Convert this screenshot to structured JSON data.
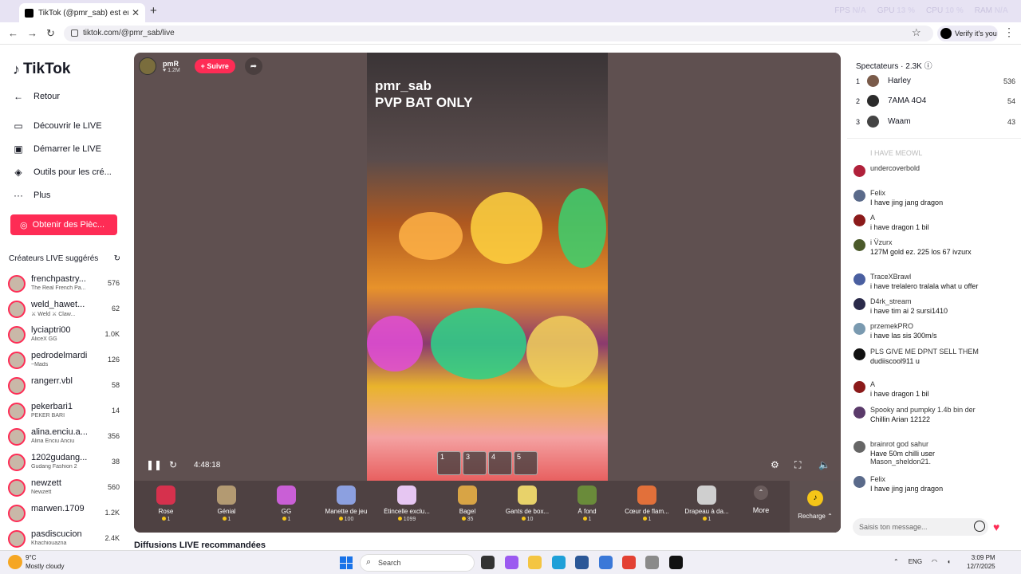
{
  "browser": {
    "tab_title": "TikTok (@pmr_sab) est en LIV",
    "url": "tiktok.com/@pmr_sab/live",
    "verify_label": "Verify it's you",
    "perf": [
      {
        "label": "FPS",
        "value": "N/A"
      },
      {
        "label": "GPU",
        "value": "13 %"
      },
      {
        "label": "CPU",
        "value": "10 %"
      },
      {
        "label": "RAM",
        "value": "N/A"
      }
    ]
  },
  "sidebar": {
    "logo": "TikTok",
    "nav": [
      "Retour",
      "Découvrir le LIVE",
      "Démarrer le LIVE",
      "Outils pour les cré...",
      "Plus"
    ],
    "coins_button": "Obtenir des Pièc...",
    "suggested_title": "Créateurs LIVE suggérés",
    "creators": [
      {
        "name": "frenchpastry...",
        "sub": "The Real French Pa...",
        "count": "576"
      },
      {
        "name": "weld_hawet...",
        "sub": "⚔ Weld ⚔ Claw...",
        "count": "62"
      },
      {
        "name": "lyciaptri00",
        "sub": "AliceX GG",
        "count": "1.0K"
      },
      {
        "name": "pedrodelmardi",
        "sub": "~Mads",
        "count": "126"
      },
      {
        "name": "rangerr.vbl",
        "sub": "",
        "count": "58"
      },
      {
        "name": "pekerbari1",
        "sub": "PEKER BARI",
        "count": "14"
      },
      {
        "name": "alina.enciu.a...",
        "sub": "Alina Enciu Anciu",
        "count": "356"
      },
      {
        "name": "1202gudang...",
        "sub": "Gudang Fashion 2",
        "count": "38"
      },
      {
        "name": "newzett",
        "sub": "Newzett",
        "count": "560"
      },
      {
        "name": "marwen.1709",
        "sub": "",
        "count": "1.2K"
      },
      {
        "name": "pasdiscucion",
        "sub": "Khachiouazna",
        "count": "2.4K"
      }
    ]
  },
  "live": {
    "host_name": "pmR",
    "host_likes": "1.2M",
    "follow_label": "+ Suivre",
    "streamer_overlay": "pmr_sab",
    "caption": "PVP BAT ONLY",
    "elapsed": "4:48:18",
    "hotbar": [
      "1",
      "3",
      "4",
      "5"
    ]
  },
  "gifts": [
    {
      "name": "Rose",
      "price": "1",
      "color": "#d6314d"
    },
    {
      "name": "Génial",
      "price": "1",
      "color": "#b39a72"
    },
    {
      "name": "GG",
      "price": "1",
      "color": "#c95fd6"
    },
    {
      "name": "Manette de jeu",
      "price": "100",
      "color": "#8ca0e0"
    },
    {
      "name": "Étincelle exclu...",
      "price": "1099",
      "color": "#e6c6f2"
    },
    {
      "name": "Bagel",
      "price": "35",
      "color": "#d8a445"
    },
    {
      "name": "Gants de box...",
      "price": "10",
      "color": "#e8d26a"
    },
    {
      "name": "À fond",
      "price": "1",
      "color": "#6a8b3a"
    },
    {
      "name": "Cœur de flam...",
      "price": "1",
      "color": "#e2703a"
    },
    {
      "name": "Drapeau à da...",
      "price": "1",
      "color": "#cfcfcf"
    }
  ],
  "more_label": "More",
  "recharge_label": "Recharge",
  "recommended_title": "Diffusions LIVE recommandées",
  "chat": {
    "spectators_label": "Spectateurs · 2.3K",
    "top": [
      {
        "rank": "1",
        "name": "Harley",
        "count": "536",
        "color": "#7a5b4a"
      },
      {
        "rank": "2",
        "name": "7AMA 4O4",
        "count": "54",
        "color": "#2b2b2b"
      },
      {
        "rank": "3",
        "name": "Waam",
        "count": "43",
        "color": "#444"
      }
    ],
    "faded": "I HAVE MEOWL",
    "messages": [
      {
        "name": "undercoverbold",
        "text": "",
        "color": "#b0203a"
      },
      {
        "name": "Felix",
        "text": "I have jing jang dragon",
        "color": "#5a6a8a"
      },
      {
        "name": "A",
        "text": "i have dragon 1 bil",
        "color": "#8b1a1a"
      },
      {
        "name": "i V̈zurx",
        "text": "127M gold ez. 225 los 67 ivzurx",
        "color": "#4b5a2a"
      },
      {
        "name": "TraceXBrawl",
        "text": "i have trelalero tralala what u offer",
        "color": "#4a5fa0"
      },
      {
        "name": "D4rk_stream",
        "text": "i have tim ai 2 sursi1410",
        "color": "#2a2a4a"
      },
      {
        "name": "przemekPRO",
        "text": "i have las sis 300m/s",
        "color": "#7a9ab0"
      },
      {
        "name": "PLS GIVE ME DPNT SELL THEM",
        "text": "dudiiscool911 u",
        "color": "#111"
      },
      {
        "name": "A",
        "text": "i have dragon 1 bil",
        "color": "#8b1a1a"
      },
      {
        "name": "Spooky and pumpky 1.4b bin der",
        "text": "Chillin Arian 12122",
        "color": "#5a3a6a"
      },
      {
        "name": "brainrot god sahur",
        "text": "Have 50m chilli user",
        "color": "#666"
      },
      {
        "name": "Mason_sheldon21.",
        "text": "",
        "color": "#999"
      },
      {
        "name": "Felix",
        "text": "I have jing jang dragon",
        "color": "#5a6a8a"
      }
    ],
    "input_placeholder": "Saisis ton message..."
  },
  "taskbar": {
    "temp": "9°C",
    "weather": "Mostly cloudy",
    "search": "Search",
    "lang": "ENG",
    "time": "3:09 PM",
    "date": "12/7/2025"
  }
}
